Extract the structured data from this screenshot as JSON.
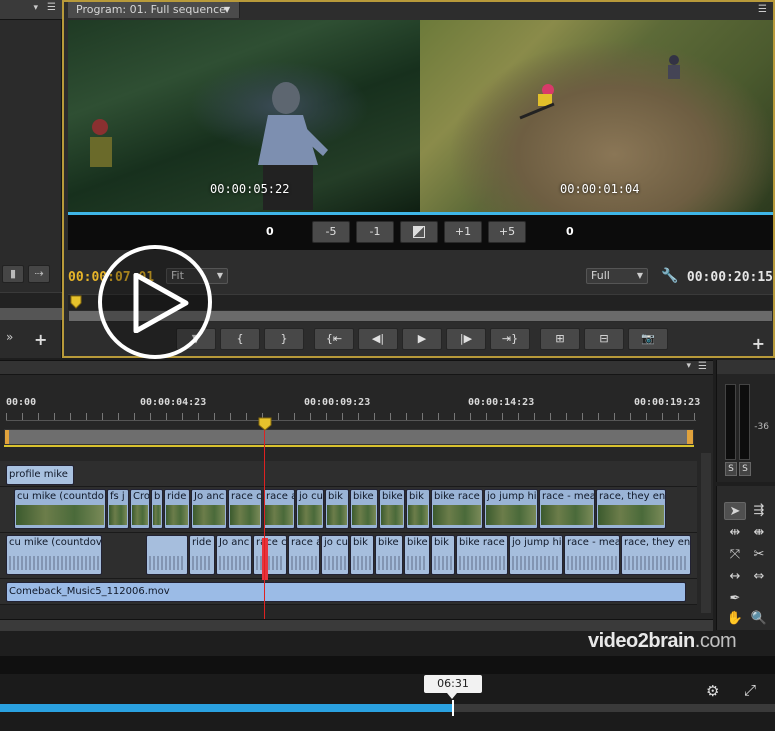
{
  "program": {
    "tab_label": "Program: 01. Full sequence",
    "overlay_left_tc": "00:00:05:22",
    "overlay_right_tc": "00:00:01:04",
    "trim_left_value": "0",
    "trim_right_value": "0",
    "trim_buttons": [
      "-5",
      "-1",
      "",
      "+1",
      "+5"
    ],
    "current_time": "00:00:07:01",
    "duration": "00:00:20:15",
    "zoom_select": "Fit",
    "quality_select": "Full"
  },
  "timeline": {
    "ruler": [
      "00:00",
      "00:00:04:23",
      "00:00:09:23",
      "00:00:14:23",
      "00:00:19:23"
    ],
    "title_clip": "profile mike",
    "video_clips": [
      "cu mike (countdo",
      "fs j",
      "Cros",
      "b",
      "ride",
      "Jo anc",
      "race c",
      "race a",
      "jo cu",
      "bik",
      "bike",
      "bike",
      "bik",
      "bike race",
      "jo jump hi",
      "race - mea",
      "race, they enc"
    ],
    "audio_clips": [
      "cu mike (countdov",
      "",
      "ride",
      "Jo anc",
      "race c",
      "race a",
      "jo cu",
      "bik",
      "bike",
      "bike",
      "bik",
      "bike race",
      "jo jump hi",
      "race - mea",
      "race, they enc"
    ],
    "music_clip": "Comeback_Music5_112006.mov"
  },
  "meter": {
    "db_label": "-36",
    "solo_left": "S",
    "solo_right": "S"
  },
  "watermark": {
    "brand": "video2brain",
    "tld": ".com"
  },
  "player": {
    "tooltip_time": "06:31",
    "progress_fraction": 0.585
  },
  "colors": {
    "accent_gold": "#b89a3a",
    "playhead_red": "#e8323c",
    "progress_blue": "#2aa1e0",
    "current_time_yellow": "#e6b429"
  }
}
